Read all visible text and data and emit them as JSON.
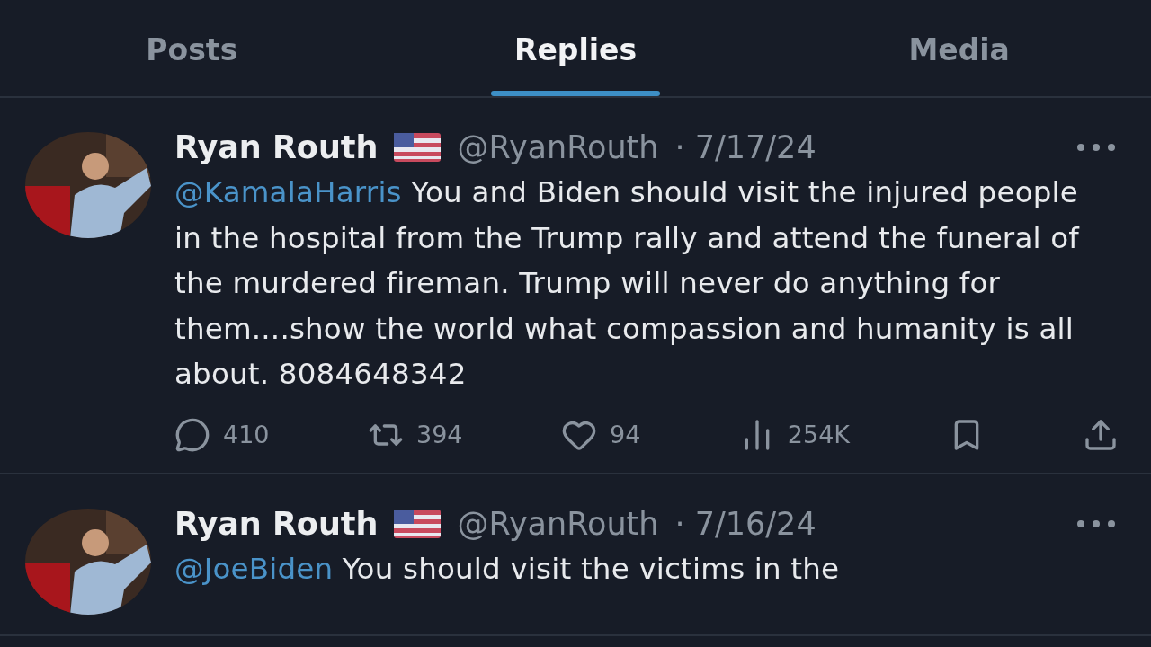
{
  "tabs": [
    {
      "label": "Posts",
      "selected": false
    },
    {
      "label": "Replies",
      "selected": true
    },
    {
      "label": "Media",
      "selected": false
    }
  ],
  "posts": [
    {
      "name": "Ryan Routh",
      "handle": "@RyanRouth",
      "date": "· 7/17/24",
      "mention": "@KamalaHarris",
      "text": "You and Biden should visit the injured people in the hospital from the Trump rally and attend the funeral of the murdered fireman. Trump will never do anything for them....show the world what compassion and humanity is all about. 8084648342",
      "replies": "410",
      "reposts": "394",
      "likes": "94",
      "views": "254K"
    },
    {
      "name": "Ryan Routh",
      "handle": "@RyanRouth",
      "date": "· 7/16/24",
      "mention": "@JoeBiden",
      "text": "You should visit the victims in the"
    }
  ]
}
